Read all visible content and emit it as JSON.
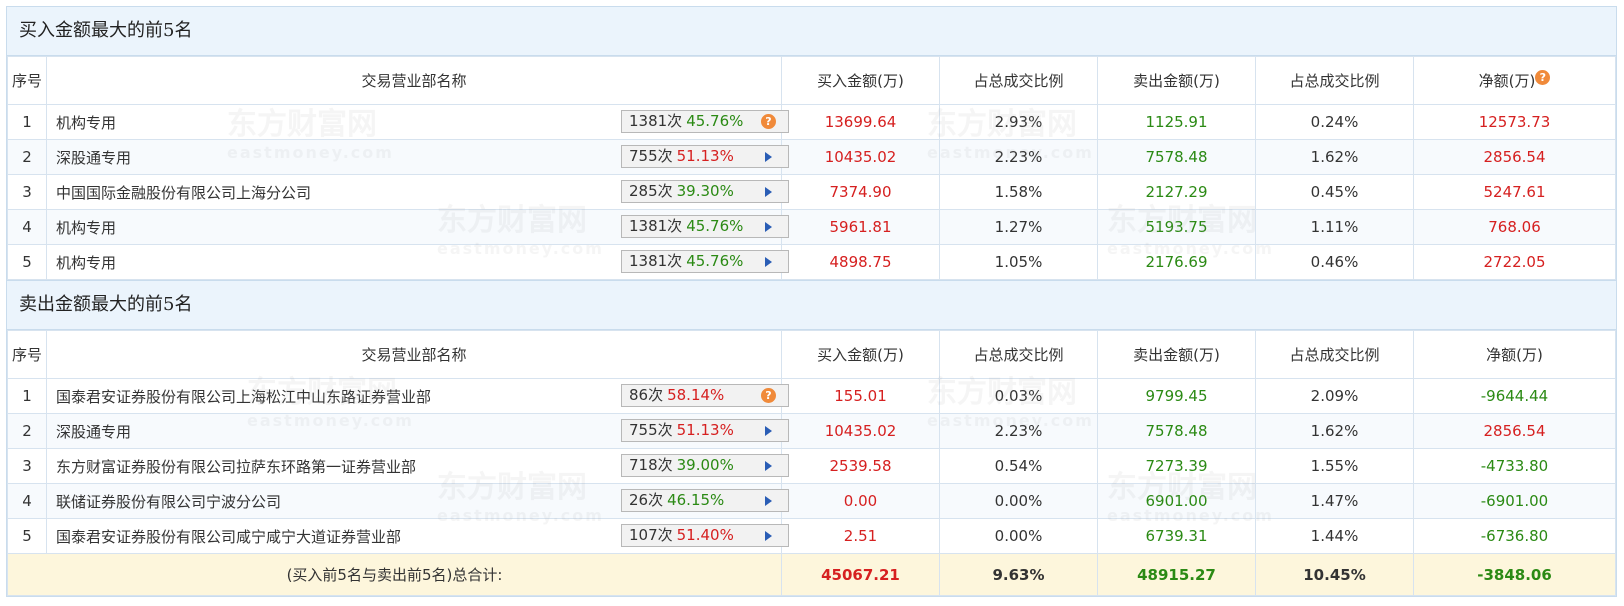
{
  "buy_section": {
    "title": "买入金额最大的前5名",
    "headers": {
      "idx": "序号",
      "name": "交易营业部名称",
      "buy": "买入金额(万)",
      "buy_pct": "占总成交比例",
      "sell": "卖出金额(万)",
      "sell_pct": "占总成交比例",
      "net": "净额(万)"
    },
    "rows": [
      {
        "idx": "1",
        "name": "机构专用",
        "count": "1381次",
        "rate": "45.76%",
        "icon": "question",
        "buy": "13699.64",
        "buy_pct": "2.93%",
        "sell": "1125.91",
        "sell_pct": "0.24%",
        "net": "12573.73"
      },
      {
        "idx": "2",
        "name": "深股通专用",
        "count": "755次",
        "rate": "51.13%",
        "icon": "arrow",
        "buy": "10435.02",
        "buy_pct": "2.23%",
        "sell": "7578.48",
        "sell_pct": "1.62%",
        "net": "2856.54"
      },
      {
        "idx": "3",
        "name": "中国国际金融股份有限公司上海分公司",
        "count": "285次",
        "rate": "39.30%",
        "icon": "arrow",
        "buy": "7374.90",
        "buy_pct": "1.58%",
        "sell": "2127.29",
        "sell_pct": "0.45%",
        "net": "5247.61"
      },
      {
        "idx": "4",
        "name": "机构专用",
        "count": "1381次",
        "rate": "45.76%",
        "icon": "arrow",
        "buy": "5961.81",
        "buy_pct": "1.27%",
        "sell": "5193.75",
        "sell_pct": "1.11%",
        "net": "768.06"
      },
      {
        "idx": "5",
        "name": "机构专用",
        "count": "1381次",
        "rate": "45.76%",
        "icon": "arrow",
        "buy": "4898.75",
        "buy_pct": "1.05%",
        "sell": "2176.69",
        "sell_pct": "0.46%",
        "net": "2722.05"
      }
    ]
  },
  "sell_section": {
    "title": "卖出金额最大的前5名",
    "headers": {
      "idx": "序号",
      "name": "交易营业部名称",
      "buy": "买入金额(万)",
      "buy_pct": "占总成交比例",
      "sell": "卖出金额(万)",
      "sell_pct": "占总成交比例",
      "net": "净额(万)"
    },
    "rows": [
      {
        "idx": "1",
        "name": "国泰君安证券股份有限公司上海松江中山东路证券营业部",
        "count": "86次",
        "rate": "58.14%",
        "icon": "question",
        "buy": "155.01",
        "buy_pct": "0.03%",
        "sell": "9799.45",
        "sell_pct": "2.09%",
        "net": "-9644.44"
      },
      {
        "idx": "2",
        "name": "深股通专用",
        "count": "755次",
        "rate": "51.13%",
        "icon": "arrow",
        "buy": "10435.02",
        "buy_pct": "2.23%",
        "sell": "7578.48",
        "sell_pct": "1.62%",
        "net": "2856.54"
      },
      {
        "idx": "3",
        "name": "东方财富证券股份有限公司拉萨东环路第一证券营业部",
        "count": "718次",
        "rate": "39.00%",
        "icon": "arrow",
        "buy": "2539.58",
        "buy_pct": "0.54%",
        "sell": "7273.39",
        "sell_pct": "1.55%",
        "net": "-4733.80"
      },
      {
        "idx": "4",
        "name": "联储证券股份有限公司宁波分公司",
        "count": "26次",
        "rate": "46.15%",
        "icon": "arrow",
        "buy": "0.00",
        "buy_pct": "0.00%",
        "sell": "6901.00",
        "sell_pct": "1.47%",
        "net": "-6901.00"
      },
      {
        "idx": "5",
        "name": "国泰君安证券股份有限公司咸宁咸宁大道证券营业部",
        "count": "107次",
        "rate": "51.40%",
        "icon": "arrow",
        "buy": "2.51",
        "buy_pct": "0.00%",
        "sell": "6739.31",
        "sell_pct": "1.44%",
        "net": "-6736.80"
      }
    ]
  },
  "total": {
    "label": "(买入前5名与卖出前5名)总合计:",
    "buy": "45067.21",
    "buy_pct": "9.63%",
    "sell": "48915.27",
    "sell_pct": "10.45%",
    "net": "-3848.06"
  },
  "watermark": {
    "brand": "东方财富网",
    "domain": "eastmoney.com"
  },
  "colors": {
    "red": "#d62020",
    "green": "#2b8a14",
    "header_bg": "#ebf4fc",
    "total_bg": "#fdf6dc",
    "help_icon": "#f08a3a",
    "arrow_icon": "#2a5db5"
  }
}
